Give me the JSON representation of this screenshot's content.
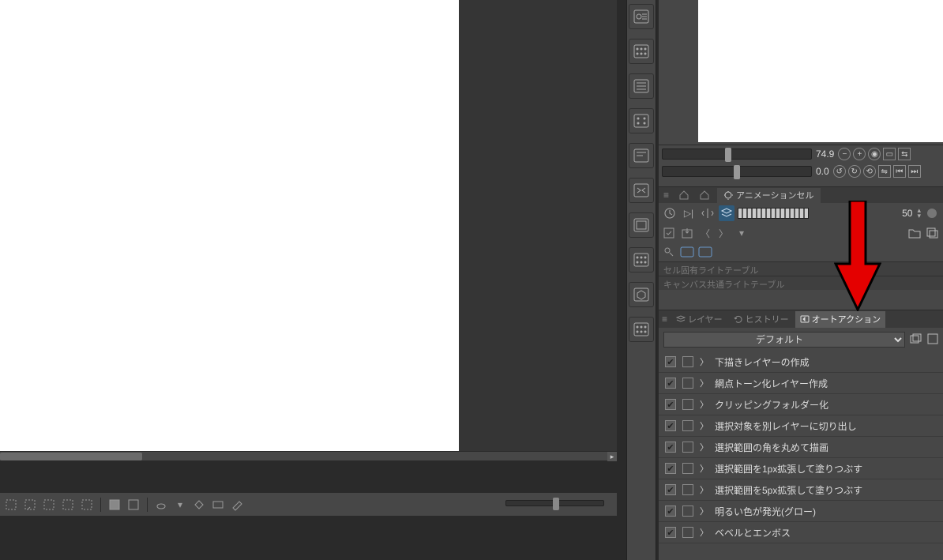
{
  "nav": {
    "zoom": "74.9",
    "rotation": "0.0"
  },
  "cel": {
    "tab_label": "アニメーションセル",
    "opacity": "50",
    "light1": "セル固有ライトテーブル",
    "light2": "キャンバス共通ライトテーブル"
  },
  "action_panel": {
    "tab_layer": "レイヤー",
    "tab_history": "ヒストリー",
    "tab_auto": "オートアクション",
    "preset": "デフォルト"
  },
  "actions": [
    {
      "label": "下描きレイヤーの作成"
    },
    {
      "label": "網点トーン化レイヤー作成"
    },
    {
      "label": "クリッピングフォルダー化"
    },
    {
      "label": "選択対象を別レイヤーに切り出し"
    },
    {
      "label": "選択範囲の角を丸めて描画"
    },
    {
      "label": "選択範囲を1px拡張して塗りつぶす"
    },
    {
      "label": "選択範囲を5px拡張して塗りつぶす"
    },
    {
      "label": "明るい色が発光(グロー)"
    },
    {
      "label": "ベベルとエンボス"
    }
  ]
}
